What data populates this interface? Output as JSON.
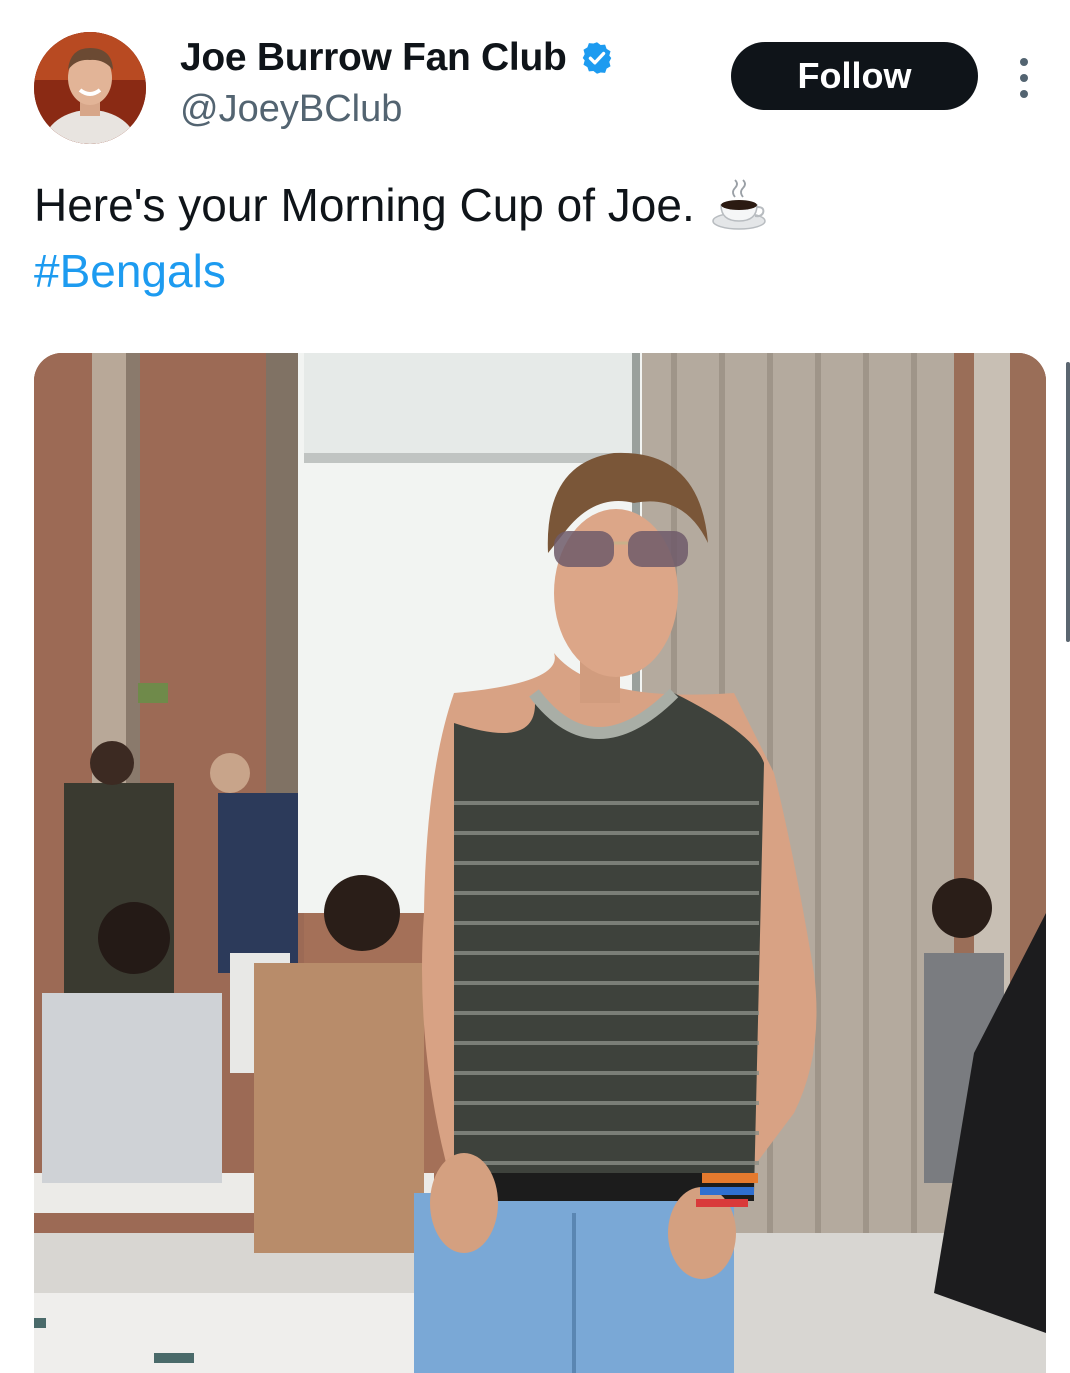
{
  "tweet": {
    "author_name": "Joe Burrow Fan Club",
    "handle": "@JoeyBClub",
    "verified_icon": "verified-badge-icon",
    "follow_label": "Follow",
    "more_icon": "more-options-icon",
    "text": "Here's your Morning Cup of Joe.",
    "emoji": "coffee-cup-icon",
    "hashtag": "#Bengals"
  },
  "colors": {
    "accent": "#1d9bf0",
    "follow_bg": "#0f1419",
    "text": "#0f1419",
    "secondary": "#536471"
  }
}
